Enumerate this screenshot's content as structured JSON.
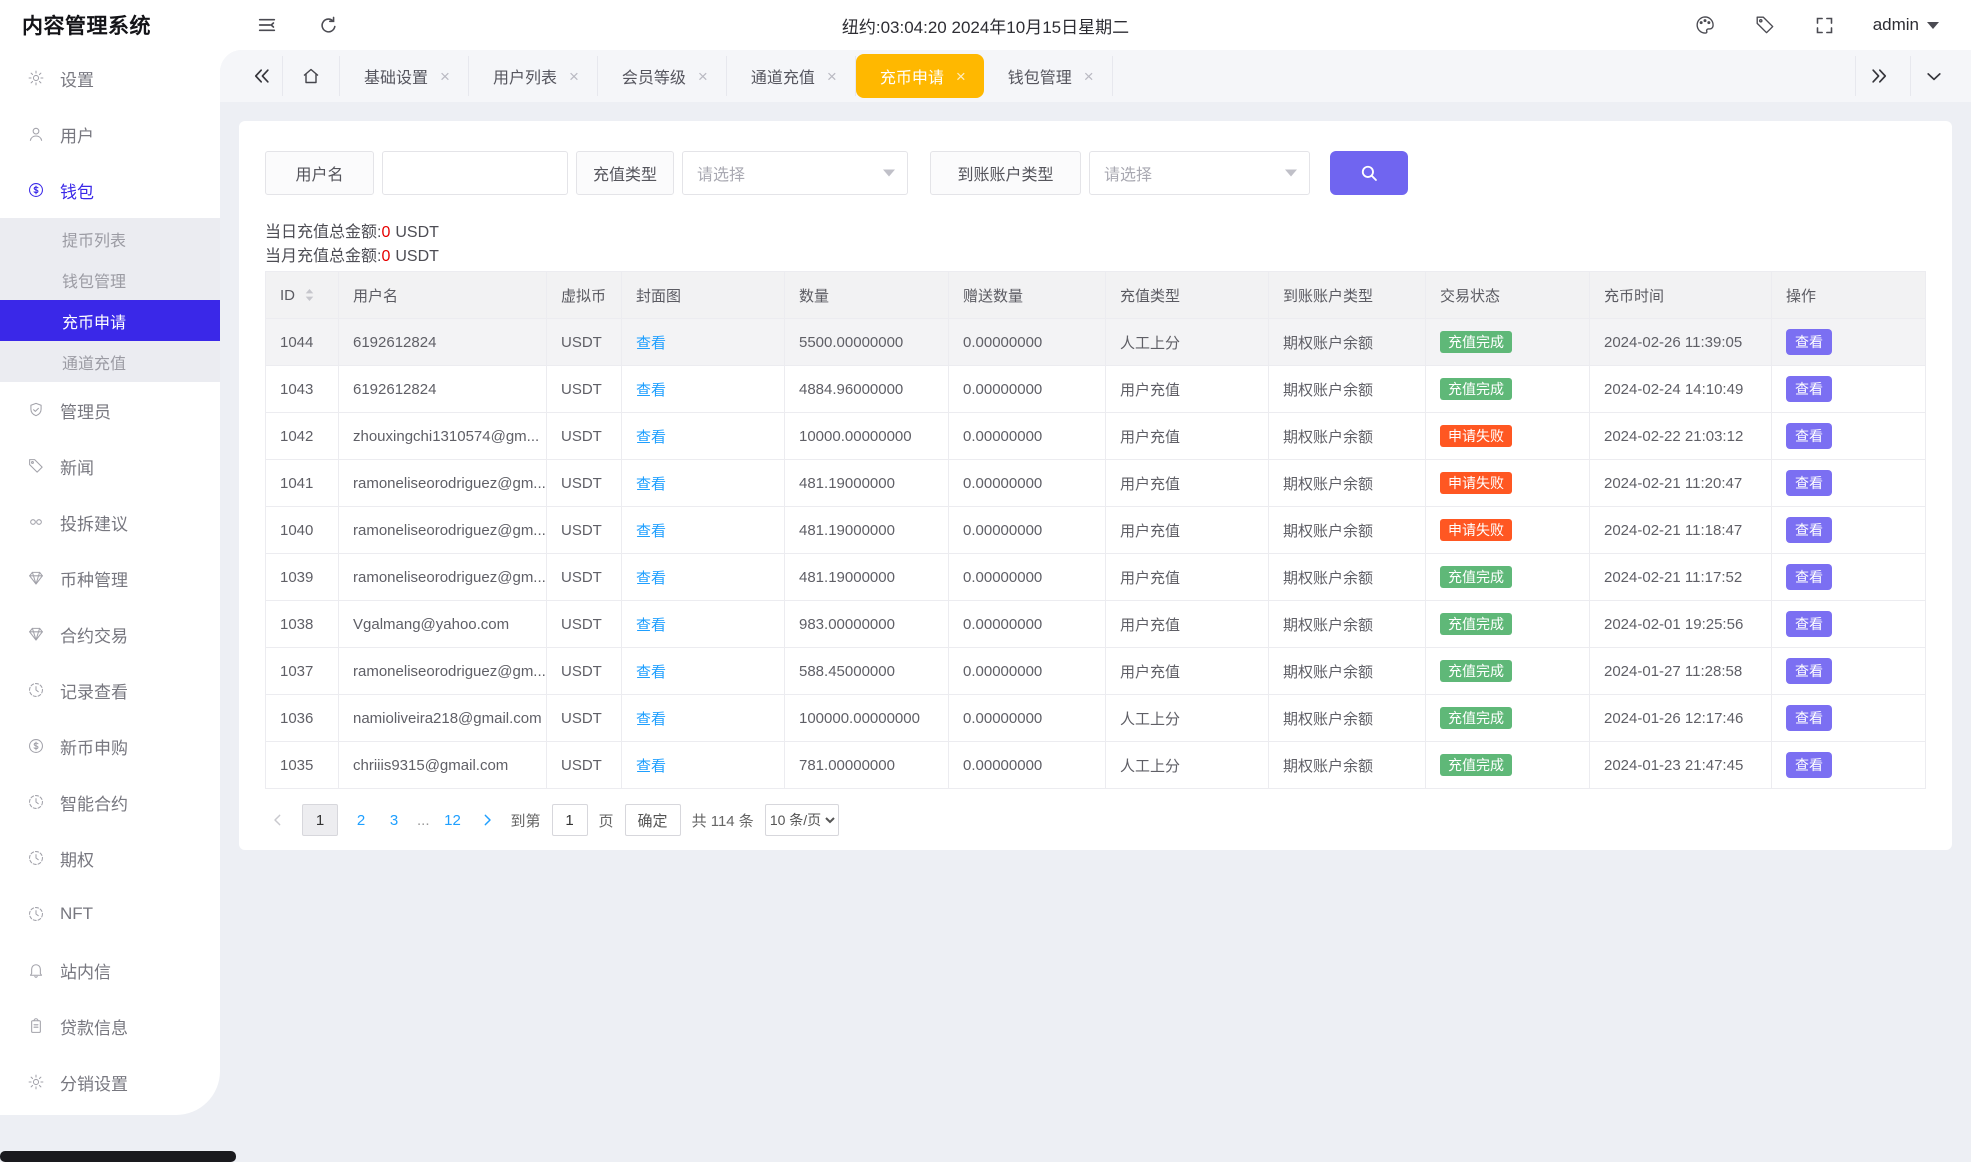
{
  "app": {
    "title": "内容管理系统",
    "clock": "纽约:03:04:20 2024年10月15日星期二",
    "user": "admin"
  },
  "colors": {
    "accent": "#3a28e8",
    "menu_active_bg": "#3a28e8",
    "tab_active": "#ffb800",
    "search_button": "#7065f0",
    "op_button": "#7b6ff2",
    "link": "#1e9fff",
    "success": "#5fb878",
    "fail": "#ff5722",
    "red_value": "#e60000"
  },
  "sidebar": {
    "items": [
      {
        "name": "settings",
        "label": "设置",
        "icon": "gear"
      },
      {
        "name": "users",
        "label": "用户",
        "icon": "user"
      },
      {
        "name": "wallet",
        "label": "钱包",
        "icon": "dollar",
        "active": true,
        "children": [
          {
            "name": "withdraw-list",
            "label": "提币列表"
          },
          {
            "name": "wallet-manage",
            "label": "钱包管理"
          },
          {
            "name": "coin-recharge-apply",
            "label": "充币申请",
            "active": true
          },
          {
            "name": "channel-recharge",
            "label": "通道充值"
          }
        ]
      },
      {
        "name": "admin",
        "label": "管理员",
        "icon": "shield"
      },
      {
        "name": "news",
        "label": "新闻",
        "icon": "tag"
      },
      {
        "name": "feedback",
        "label": "投拆建议",
        "icon": "infinity"
      },
      {
        "name": "coin-manage",
        "label": "币种管理",
        "icon": "diamond"
      },
      {
        "name": "contract-trade",
        "label": "合约交易",
        "icon": "diamond"
      },
      {
        "name": "records",
        "label": "记录查看",
        "icon": "clock"
      },
      {
        "name": "new-coin-subscribe",
        "label": "新币申购",
        "icon": "dollar"
      },
      {
        "name": "smart-contract",
        "label": "智能合约",
        "icon": "clock"
      },
      {
        "name": "options",
        "label": "期权",
        "icon": "clock"
      },
      {
        "name": "nft",
        "label": "NFT",
        "icon": "clock"
      },
      {
        "name": "messages",
        "label": "站内信",
        "icon": "bell"
      },
      {
        "name": "loan-info",
        "label": "贷款信息",
        "icon": "clipboard"
      },
      {
        "name": "distribution-settings",
        "label": "分销设置",
        "icon": "gear"
      }
    ]
  },
  "tabs": {
    "items": [
      {
        "name": "basic-settings",
        "label": "基础设置",
        "closable": true
      },
      {
        "name": "user-list",
        "label": "用户列表",
        "closable": true
      },
      {
        "name": "member-level",
        "label": "会员等级",
        "closable": true
      },
      {
        "name": "channel-recharge",
        "label": "通道充值",
        "closable": true
      },
      {
        "name": "coin-recharge-apply",
        "label": "充币申请",
        "closable": true,
        "active": true
      },
      {
        "name": "wallet-manage",
        "label": "钱包管理",
        "closable": true
      }
    ]
  },
  "filters": {
    "username_label": "用户名",
    "username_value": "",
    "recharge_type_label": "充值类型",
    "recharge_type_placeholder": "请选择",
    "account_type_label": "到账账户类型",
    "account_type_placeholder": "请选择"
  },
  "summary": {
    "daily_label": "当日充值总金额:",
    "daily_value": "0",
    "daily_unit": "USDT",
    "monthly_label": "当月充值总金额:",
    "monthly_value": "0",
    "monthly_unit": "USDT"
  },
  "table": {
    "columns": [
      "ID",
      "用户名",
      "虚拟币",
      "封面图",
      "数量",
      "赠送数量",
      "充值类型",
      "到账账户类型",
      "交易状态",
      "充币时间",
      "操作"
    ],
    "view_label": "查看",
    "rows": [
      {
        "id": "1044",
        "username": "6192612824",
        "coin": "USDT",
        "amount": "5500.00000000",
        "bonus": "0.00000000",
        "recharge_type": "人工上分",
        "account_type": "期权账户余额",
        "status": "充值完成",
        "status_type": "success",
        "time": "2024-02-26 11:39:05"
      },
      {
        "id": "1043",
        "username": "6192612824",
        "coin": "USDT",
        "amount": "4884.96000000",
        "bonus": "0.00000000",
        "recharge_type": "用户充值",
        "account_type": "期权账户余额",
        "status": "充值完成",
        "status_type": "success",
        "time": "2024-02-24 14:10:49"
      },
      {
        "id": "1042",
        "username": "zhouxingchi1310574@gm...",
        "coin": "USDT",
        "amount": "10000.00000000",
        "bonus": "0.00000000",
        "recharge_type": "用户充值",
        "account_type": "期权账户余额",
        "status": "申请失败",
        "status_type": "fail",
        "time": "2024-02-22 21:03:12"
      },
      {
        "id": "1041",
        "username": "ramoneliseorodriguez@gm...",
        "coin": "USDT",
        "amount": "481.19000000",
        "bonus": "0.00000000",
        "recharge_type": "用户充值",
        "account_type": "期权账户余额",
        "status": "申请失败",
        "status_type": "fail",
        "time": "2024-02-21 11:20:47"
      },
      {
        "id": "1040",
        "username": "ramoneliseorodriguez@gm...",
        "coin": "USDT",
        "amount": "481.19000000",
        "bonus": "0.00000000",
        "recharge_type": "用户充值",
        "account_type": "期权账户余额",
        "status": "申请失败",
        "status_type": "fail",
        "time": "2024-02-21 11:18:47"
      },
      {
        "id": "1039",
        "username": "ramoneliseorodriguez@gm...",
        "coin": "USDT",
        "amount": "481.19000000",
        "bonus": "0.00000000",
        "recharge_type": "用户充值",
        "account_type": "期权账户余额",
        "status": "充值完成",
        "status_type": "success",
        "time": "2024-02-21 11:17:52"
      },
      {
        "id": "1038",
        "username": "Vgalmang@yahoo.com",
        "coin": "USDT",
        "amount": "983.00000000",
        "bonus": "0.00000000",
        "recharge_type": "用户充值",
        "account_type": "期权账户余额",
        "status": "充值完成",
        "status_type": "success",
        "time": "2024-02-01 19:25:56"
      },
      {
        "id": "1037",
        "username": "ramoneliseorodriguez@gm...",
        "coin": "USDT",
        "amount": "588.45000000",
        "bonus": "0.00000000",
        "recharge_type": "用户充值",
        "account_type": "期权账户余额",
        "status": "充值完成",
        "status_type": "success",
        "time": "2024-01-27 11:28:58"
      },
      {
        "id": "1036",
        "username": "namioliveira218@gmail.com",
        "coin": "USDT",
        "amount": "100000.00000000",
        "bonus": "0.00000000",
        "recharge_type": "人工上分",
        "account_type": "期权账户余额",
        "status": "充值完成",
        "status_type": "success",
        "time": "2024-01-26 12:17:46"
      },
      {
        "id": "1035",
        "username": "chriiis9315@gmail.com",
        "coin": "USDT",
        "amount": "781.00000000",
        "bonus": "0.00000000",
        "recharge_type": "人工上分",
        "account_type": "期权账户余额",
        "status": "充值完成",
        "status_type": "success",
        "time": "2024-01-23 21:47:45"
      }
    ]
  },
  "pagination": {
    "pages": [
      "1",
      "2",
      "3",
      "...",
      "12"
    ],
    "current": "1",
    "goto_label": "到第",
    "goto_value": "1",
    "page_word": "页",
    "confirm_label": "确定",
    "total_label": "共 114 条",
    "per_page": "10 条/页"
  }
}
